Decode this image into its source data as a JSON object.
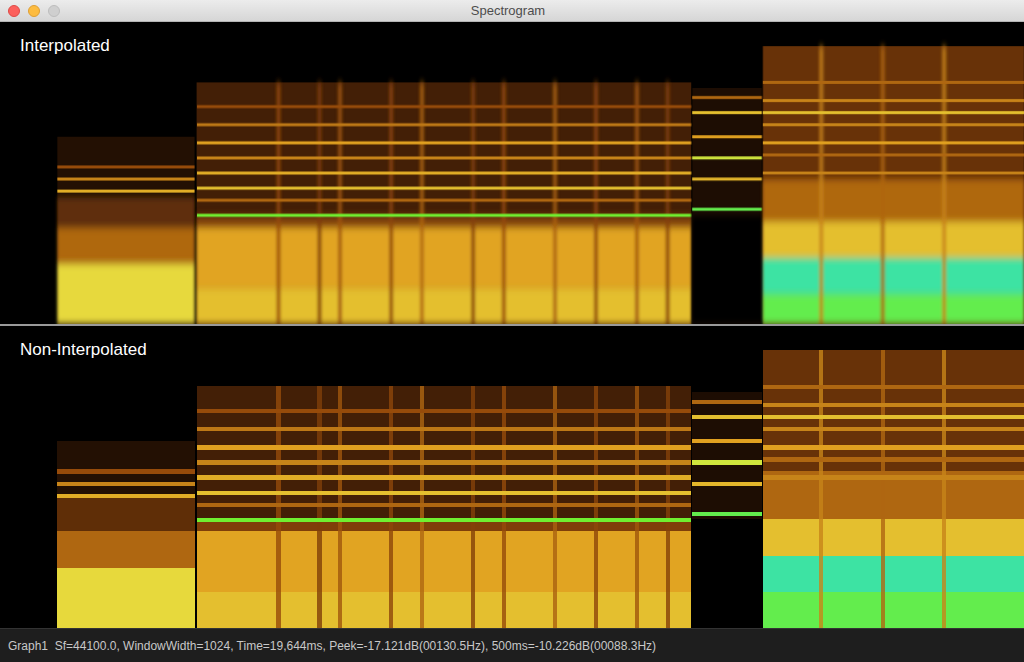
{
  "window": {
    "title": "Spectrogram",
    "controls": [
      {
        "kind": "close",
        "disabled": false
      },
      {
        "kind": "minimize",
        "disabled": false
      },
      {
        "kind": "zoom",
        "disabled": true
      }
    ]
  },
  "panels": [
    {
      "label": "Interpolated",
      "interpolated": true
    },
    {
      "label": "Non-Interpolated",
      "interpolated": false
    }
  ],
  "segments": [
    {
      "start": 0.056,
      "end": 0.19,
      "top": 0.62,
      "fill": 0.12,
      "bands": [
        {
          "pos": 0.0,
          "width": 0.2,
          "level": 0.68
        },
        {
          "pos": 0.2,
          "width": 0.12,
          "level": 0.45
        },
        {
          "pos": 0.32,
          "width": 0.1,
          "level": 0.28
        }
      ],
      "lines": [
        {
          "pos": 0.44,
          "level": 0.58
        },
        {
          "pos": 0.48,
          "level": 0.5
        },
        {
          "pos": 0.52,
          "level": 0.4
        }
      ],
      "onsets": []
    },
    {
      "start": 0.192,
      "end": 0.675,
      "top": 0.8,
      "fill": 0.22,
      "bands": [
        {
          "pos": 0.0,
          "width": 0.12,
          "level": 0.62
        },
        {
          "pos": 0.12,
          "width": 0.2,
          "level": 0.56
        },
        {
          "pos": 0.32,
          "width": 0.04,
          "level": 0.35
        }
      ],
      "lines": [
        {
          "pos": 0.36,
          "level": 0.8
        },
        {
          "pos": 0.41,
          "level": 0.45
        },
        {
          "pos": 0.45,
          "level": 0.62
        },
        {
          "pos": 0.5,
          "level": 0.58
        },
        {
          "pos": 0.55,
          "level": 0.5
        },
        {
          "pos": 0.6,
          "level": 0.55
        },
        {
          "pos": 0.66,
          "level": 0.48
        },
        {
          "pos": 0.72,
          "level": 0.4
        }
      ],
      "onsets": [
        {
          "x": 0.27,
          "level": 0.4
        },
        {
          "x": 0.31,
          "level": 0.35
        },
        {
          "x": 0.33,
          "level": 0.42
        },
        {
          "x": 0.38,
          "level": 0.38
        },
        {
          "x": 0.41,
          "level": 0.45
        },
        {
          "x": 0.46,
          "level": 0.36
        },
        {
          "x": 0.49,
          "level": 0.4
        },
        {
          "x": 0.54,
          "level": 0.44
        },
        {
          "x": 0.58,
          "level": 0.38
        },
        {
          "x": 0.62,
          "level": 0.42
        },
        {
          "x": 0.65,
          "level": 0.36
        }
      ]
    },
    {
      "start": 0.676,
      "end": 0.744,
      "top": 0.78,
      "fill": 0.1,
      "bands": [
        {
          "pos": 0.0,
          "width": 0.36,
          "level": 0.0
        }
      ],
      "lines": [
        {
          "pos": 0.38,
          "level": 0.82
        },
        {
          "pos": 0.48,
          "level": 0.6
        },
        {
          "pos": 0.55,
          "level": 0.72
        },
        {
          "pos": 0.62,
          "level": 0.55
        },
        {
          "pos": 0.7,
          "level": 0.62
        },
        {
          "pos": 0.75,
          "level": 0.45
        }
      ],
      "onsets": []
    },
    {
      "start": 0.745,
      "end": 1.0,
      "top": 0.92,
      "fill": 0.3,
      "bands": [
        {
          "pos": 0.0,
          "width": 0.1,
          "level": 0.82
        },
        {
          "pos": 0.1,
          "width": 0.12,
          "level": 0.88
        },
        {
          "pos": 0.22,
          "width": 0.12,
          "level": 0.62
        },
        {
          "pos": 0.34,
          "width": 0.14,
          "level": 0.45
        }
      ],
      "lines": [
        {
          "pos": 0.5,
          "level": 0.5
        },
        {
          "pos": 0.56,
          "level": 0.45
        },
        {
          "pos": 0.6,
          "level": 0.55
        },
        {
          "pos": 0.66,
          "level": 0.5
        },
        {
          "pos": 0.7,
          "level": 0.62
        },
        {
          "pos": 0.74,
          "level": 0.5
        },
        {
          "pos": 0.8,
          "level": 0.45
        }
      ],
      "onsets": [
        {
          "x": 0.8,
          "level": 0.5
        },
        {
          "x": 0.86,
          "level": 0.45
        },
        {
          "x": 0.92,
          "level": 0.5
        }
      ]
    }
  ],
  "status_bar": "Graph1  Sf=44100.0, WindowWidth=1024, Time=19,644ms, Peek=-17.121dB(00130.5Hz), 500ms=-10.226dB(00088.3Hz)"
}
